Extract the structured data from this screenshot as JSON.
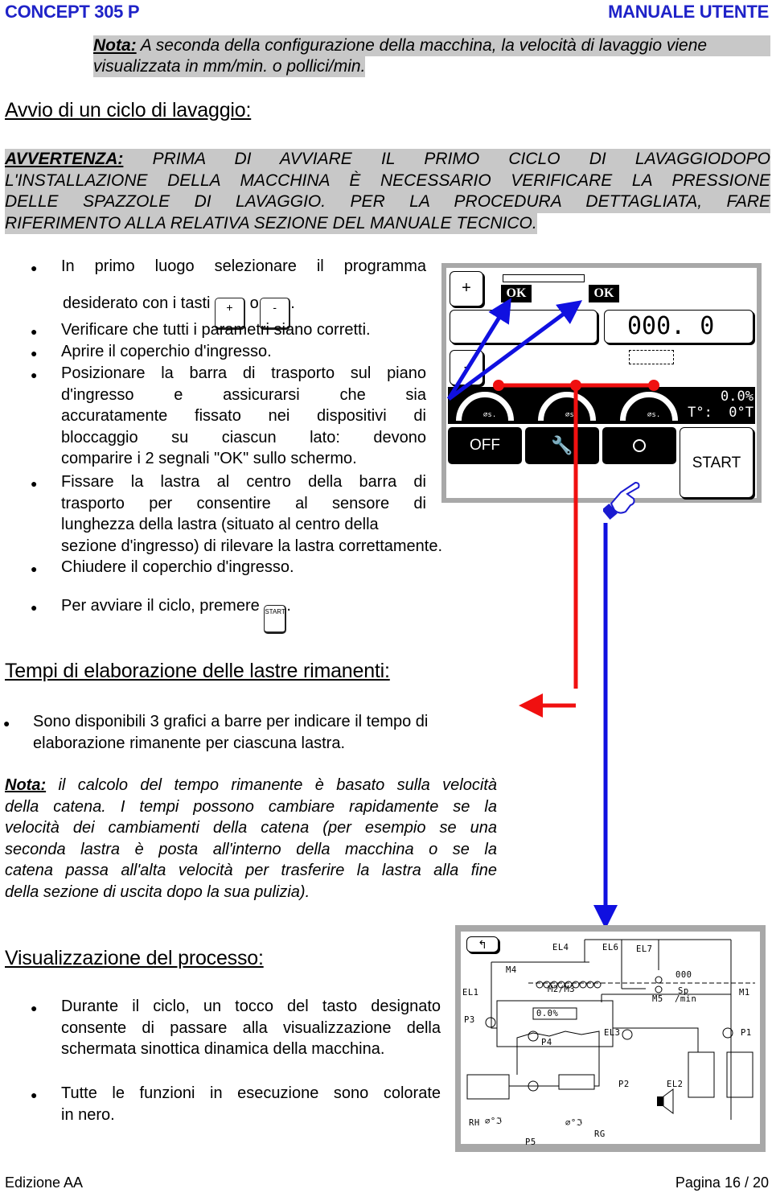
{
  "header": {
    "left": "CONCEPT 305 P",
    "right": "MANUALE UTENTE"
  },
  "note_top": {
    "label": "Nota:",
    "line1": " A seconda della configurazione della macchina, la velocità di lavaggio viene",
    "line2": "visualizzata in mm/min. o pollici/min."
  },
  "section1": {
    "title": "Avvio di un ciclo di lavaggio:",
    "warning": {
      "label": "AVVERTENZA:",
      "lines": [
        " PRIMA DI AVVIARE IL PRIMO CICLO DI LAVAGGIODOPO",
        "L'INSTALLAZIONE DELLA MACCHINA È NECESSARIO VERIFICARE LA PRESSIONE",
        "DELLE SPAZZOLE DI LAVAGGIO. PER LA PROCEDURA DETTAGLIATA, FARE",
        "RIFERIMENTO ALLA RELATIVA SEZIONE DEL MANUALE TECNICO."
      ]
    },
    "steps": {
      "s1_line1": "In primo luogo selezionare il programma",
      "s1_line2_a": "desiderato con i tasti",
      "s1_or": "o",
      "s1_end": ".",
      "key_plus": "+",
      "key_minus": "-",
      "s2": "Verificare che tutti i parametri siano corretti.",
      "s3": "Aprire il coperchio d'ingresso.",
      "s4": [
        "Posizionare la barra di trasporto sul piano",
        "d'ingresso e assicurarsi che sia",
        "accuratamente fissato nei dispositivi di",
        "bloccaggio su ciascun lato: devono",
        "comparire i 2 segnali \"OK\" sullo schermo."
      ],
      "s5": [
        "Fissare la lastra al centro della barra di",
        "trasporto per consentire al sensore di",
        "lunghezza della lastra (situato al centro della",
        "sezione d'ingresso) di rilevare la lastra correttamente."
      ],
      "s6": "Chiudere il coperchio d'ingresso.",
      "s7": "Per avviare il ciclo, premere",
      "s7_end": ".",
      "key_start": "START"
    }
  },
  "screen1": {
    "btn_plus": "+",
    "btn_minus": "-",
    "ok_left": "OK",
    "ok_right": "OK",
    "speed_value": "000. 0",
    "gauge_labels": [
      "⌀s.",
      "⌀s.",
      "⌀s."
    ],
    "percent": "0.0%",
    "temperature": "T°:  0°T",
    "btn_off": "OFF",
    "btn_start": "START",
    "icons": [
      "wrench-icon",
      "magnifier-icon"
    ]
  },
  "section2": {
    "title": "Tempi di elaborazione delle lastre rimanenti:",
    "bullet": [
      "Sono disponibili 3 grafici a barre per indicare il tempo di",
      "elaborazione rimanente per ciascuna lastra."
    ],
    "note_label": "Nota:",
    "note_lines": [
      " il calcolo del tempo rimanente è basato sulla velocità",
      "della catena. I tempi possono cambiare rapidamente se la",
      "velocità dei cambiamenti della catena (per esempio se una",
      "seconda lastra è posta all'interno della macchina o se la",
      "catena passa all'alta velocità per trasferire la lastra alla fine",
      "della sezione di uscita dopo la sua pulizia)."
    ]
  },
  "section3": {
    "title": "Visualizzazione del processo:",
    "bullet1": [
      "Durante il ciclo, un tocco del tasto designato",
      "consente di passare alla visualizzazione della",
      "schermata sinottica dinamica della macchina."
    ],
    "bullet2": [
      "Tutte le funzioni in esecuzione sono colorate",
      "in nero."
    ]
  },
  "screen2": {
    "labels": {
      "el1": "EL1",
      "el2": "EL2",
      "el3": "EL3",
      "el4": "EL4",
      "el6": "EL6",
      "el7": "EL7",
      "m1": "M1",
      "m2m3": "M2/M3",
      "m4": "M4",
      "m5": "M5",
      "p1": "P1",
      "p2": "P2",
      "p3": "P3",
      "p4": "P4",
      "p5": "P5",
      "sp": "Sp",
      "min": "/min",
      "counter": "000",
      "percent": "0.0%",
      "rh": "RH",
      "rg": "RG",
      "temp1": "⌀°ℑ",
      "temp2": "⌀°ℑ"
    }
  },
  "footer": {
    "left": "Edizione AA",
    "right": "Pagina 16 / 20"
  }
}
